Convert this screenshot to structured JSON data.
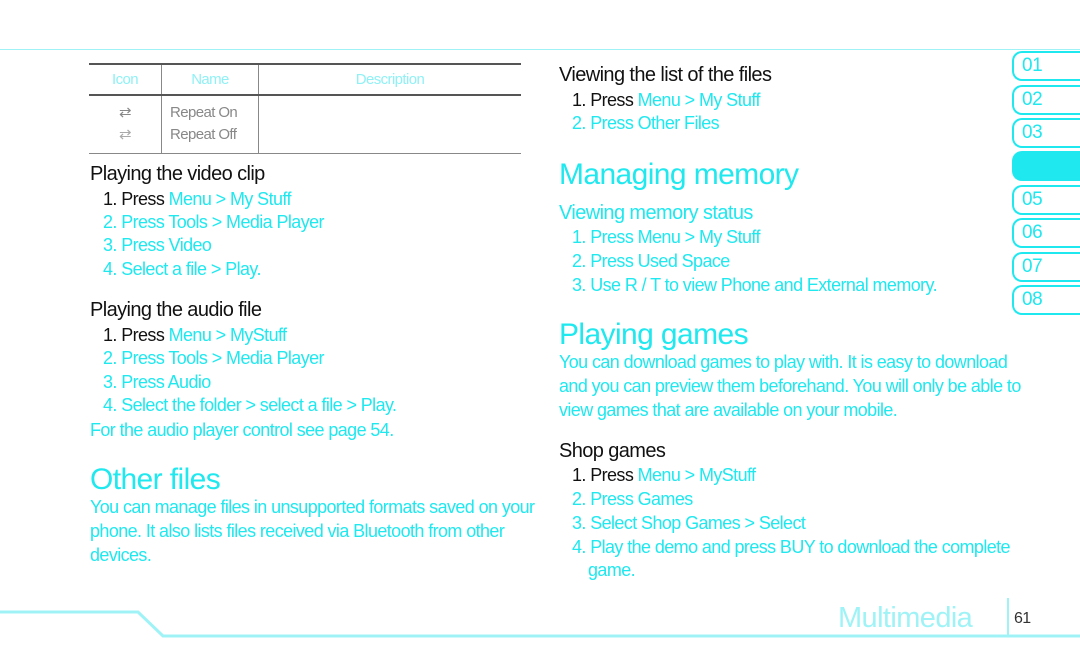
{
  "colors": {
    "accent": "#1fe8ef",
    "text": "#111111",
    "footer_title": "#9ff3f6"
  },
  "table": {
    "headers": [
      "Icon",
      "Name",
      "Description"
    ],
    "rows": [
      {
        "icon": "repeat-on-icon",
        "name": "Repeat On"
      },
      {
        "icon": "repeat-off-icon",
        "name": "Repeat Off"
      }
    ]
  },
  "video": {
    "title": "Playing the video clip",
    "steps": [
      {
        "pre": "1. Press ",
        "hl": "Menu > My Stuff"
      },
      {
        "pre": "2. Press ",
        "hl": "Tools > Media Player"
      },
      {
        "pre": "3. Press ",
        "hl": "Video"
      },
      {
        "pre": "4. Select a file > ",
        "hl": "Play."
      }
    ]
  },
  "audio": {
    "title": "Playing the audio file",
    "steps": [
      {
        "pre": "1. Press ",
        "hl": "Menu > MyStuff"
      },
      {
        "pre": "2. Press ",
        "hl": "Tools > Media Player"
      },
      {
        "pre": "3. Press ",
        "hl": "Audio"
      },
      {
        "pre": "4. Select the folder > select a file > ",
        "hl": "Play."
      }
    ],
    "note": "For the audio player control see page 54."
  },
  "other": {
    "title": "Other files",
    "lines": [
      "You can manage files in unsupported formats saved on your",
      "phone. It also lists files received via Bluetooth from other",
      "devices."
    ]
  },
  "list": {
    "title": "Viewing the list of the files",
    "steps": [
      {
        "pre": "1. Press ",
        "hl": "Menu > My Stuff"
      },
      {
        "pre": "2. Press ",
        "hl": "Other Files"
      }
    ]
  },
  "memory": {
    "title": "Managing memory",
    "subtitle": "Viewing memory status",
    "steps": [
      {
        "pre": "1. Press ",
        "hl": "Menu > My Stuff"
      },
      {
        "pre": "2. Press ",
        "hl": "Used Space"
      },
      {
        "pre": "3. Use ",
        "hl": "R / T  to view Phone and External memory."
      }
    ]
  },
  "games": {
    "title": "Playing games",
    "lines": [
      "You can download games to play with. It is easy to download",
      "and you can preview them beforehand. You will only be able to",
      "view games that are available on your mobile."
    ],
    "shop_title": "Shop games",
    "steps": [
      {
        "pre": "1. Press ",
        "hl": "Menu > MyStuff"
      },
      {
        "pre": "2. Press ",
        "hl": "Games"
      },
      {
        "pre": "3. Select ",
        "hl": "Shop Games > Select"
      },
      {
        "pre": "4. ",
        "hl": "Play the demo and press BUY to download the complete"
      }
    ],
    "step4_cont": "game."
  },
  "tabs": [
    "01",
    "02",
    "03",
    "",
    "05",
    "06",
    "07",
    "08"
  ],
  "active_tab": 4,
  "footer": {
    "section": "Multimedia",
    "page": "61"
  }
}
